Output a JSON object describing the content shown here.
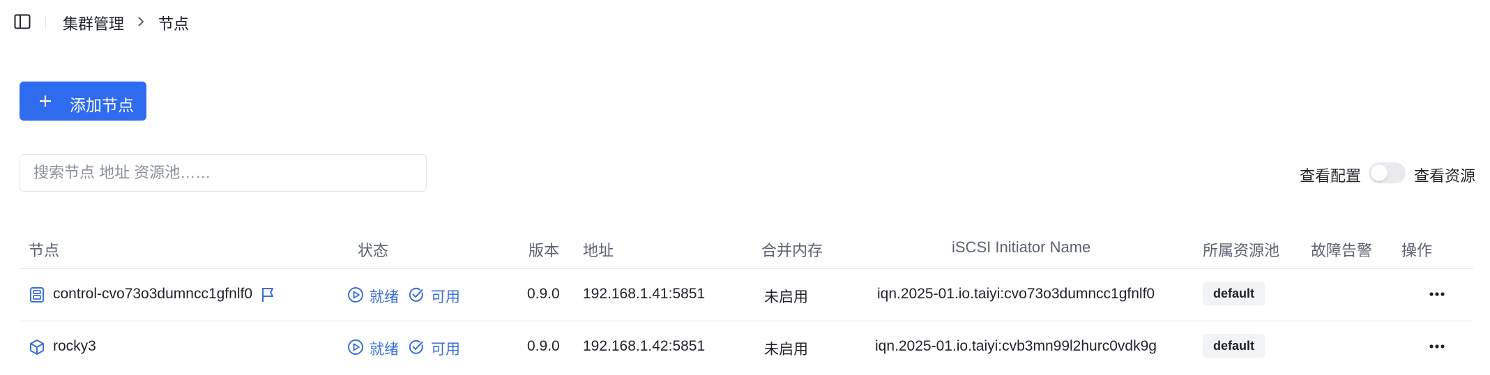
{
  "breadcrumb": {
    "parent": "集群管理",
    "current": "节点"
  },
  "toolbar": {
    "add_label": "添加节点"
  },
  "search": {
    "placeholder": "搜索节点 地址 资源池……",
    "value": ""
  },
  "view_toggle": {
    "left_label": "查看配置",
    "right_label": "查看资源",
    "on": false
  },
  "table": {
    "headers": {
      "node": "节点",
      "status": "状态",
      "version": "版本",
      "address": "地址",
      "merge": "合并内存",
      "iscsi": "iSCSI Initiator Name",
      "pool": "所属资源池",
      "alarm": "故障告警",
      "action": "操作"
    },
    "rows": [
      {
        "node": "control-cvo73o3dumncc1gfnlf0",
        "node_icon": "server-icon",
        "flagged": true,
        "status_run": "就绪",
        "status_avail": "可用",
        "version": "0.9.0",
        "address": "192.168.1.41:5851",
        "merge": "未启用",
        "iscsi": "iqn.2025-01.io.taiyi:cvo73o3dumncc1gfnlf0",
        "pool": "default",
        "alarm": ""
      },
      {
        "node": "rocky3",
        "node_icon": "cube-icon",
        "flagged": false,
        "status_run": "就绪",
        "status_avail": "可用",
        "version": "0.9.0",
        "address": "192.168.1.42:5851",
        "merge": "未启用",
        "iscsi": "iqn.2025-01.io.taiyi:cvb3mn99l2hurc0vdk9g",
        "pool": "default",
        "alarm": ""
      }
    ]
  },
  "colors": {
    "primary": "#2f6bef",
    "status": "#3a6fd8"
  }
}
